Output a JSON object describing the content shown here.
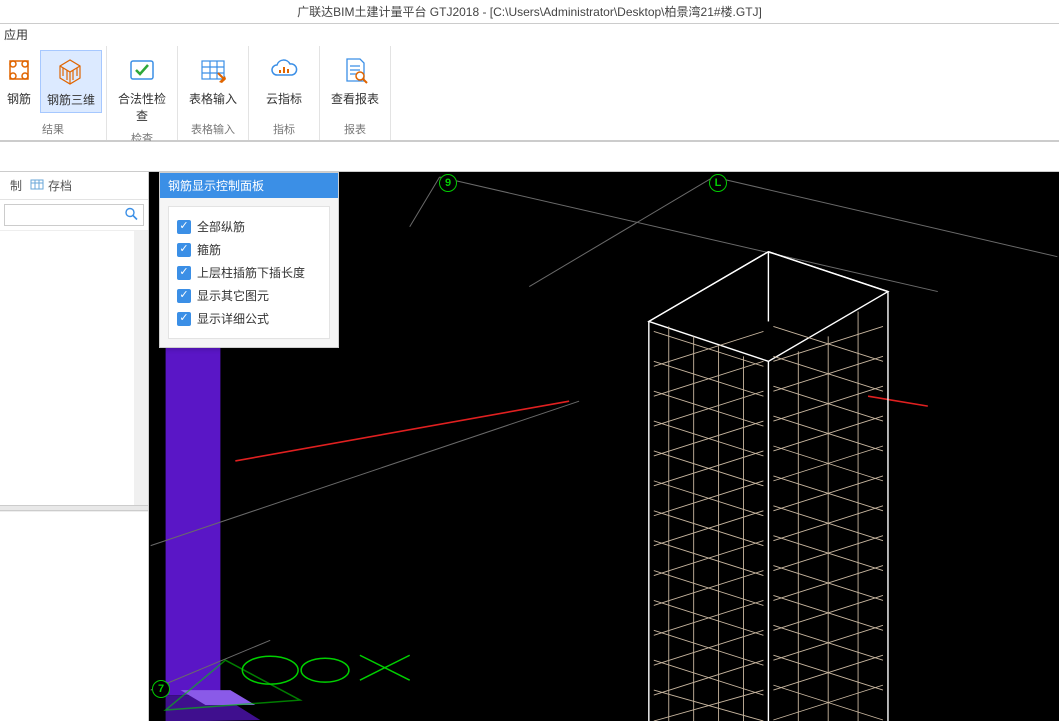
{
  "title": "广联达BIM土建计量平台 GTJ2018 - [C:\\Users\\Administrator\\Desktop\\柏景湾21#楼.GTJ]",
  "menu": {
    "app": "应用"
  },
  "ribbon": {
    "g0": {
      "btn1": "钢筋",
      "btn2": "钢筋三维",
      "label": "结果"
    },
    "g1": {
      "btn1": "合法性检查",
      "label": "检查"
    },
    "g2": {
      "btn1": "表格输入",
      "label": "表格输入"
    },
    "g3": {
      "btn1": "云指标",
      "label": "指标"
    },
    "g4": {
      "btn1": "查看报表",
      "label": "报表"
    }
  },
  "side": {
    "copy": "制",
    "archive": "存档"
  },
  "panel": {
    "title": "钢筋显示控制面板",
    "opts": {
      "o1": "全部纵筋",
      "o2": "箍筋",
      "o3": "上层柱插筋下插长度",
      "o4": "显示其它图元",
      "o5": "显示详细公式"
    }
  },
  "axes": {
    "a9": "9",
    "aL": "L",
    "a7": "7"
  }
}
